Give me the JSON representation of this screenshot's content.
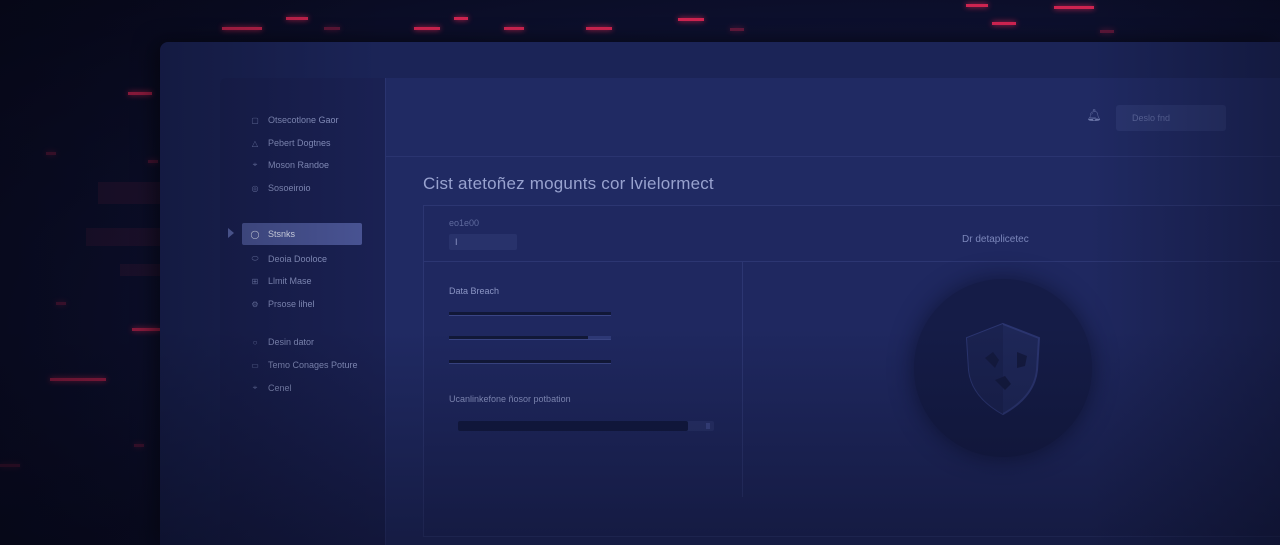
{
  "sidebar": {
    "items": [
      {
        "label": "Otsecotlone Gaor",
        "icon": "square-icon"
      },
      {
        "label": "Pebert Dogtnes",
        "icon": "triangle-icon"
      },
      {
        "label": "Moson Randoe",
        "icon": "pin-icon"
      },
      {
        "label": "Sosoeiroio",
        "icon": "circle-dot-icon"
      },
      {
        "label": "Stsnks",
        "icon": "refresh-icon",
        "active": true
      },
      {
        "label": "Deoia Dooloce",
        "icon": "ellipse-icon"
      },
      {
        "label": "Llmit Mase",
        "icon": "grid-icon"
      },
      {
        "label": "Prsose lihel",
        "icon": "gear-icon"
      },
      {
        "label": "Desin dator",
        "icon": "ring-icon"
      },
      {
        "label": "Temo Conages Poture",
        "icon": "dash-icon"
      },
      {
        "label": "Cenel",
        "icon": "pin-icon"
      }
    ]
  },
  "header": {
    "button_label": "Deslo fnd",
    "bell_icon": "bell-icon"
  },
  "main": {
    "title": "Cist atetoñez mogunts cor lvielormect",
    "stat_label": "eo1e00",
    "stat_value": "I",
    "right_panel_label": "Dr detaplicetec",
    "section1_title": "Data Breach",
    "section2_title": "Ucanlinkefone ñosor potbation",
    "progress_fraction": 0.9
  },
  "colors": {
    "accent": "#4a5596",
    "alert_red": "#ff2a5a"
  }
}
